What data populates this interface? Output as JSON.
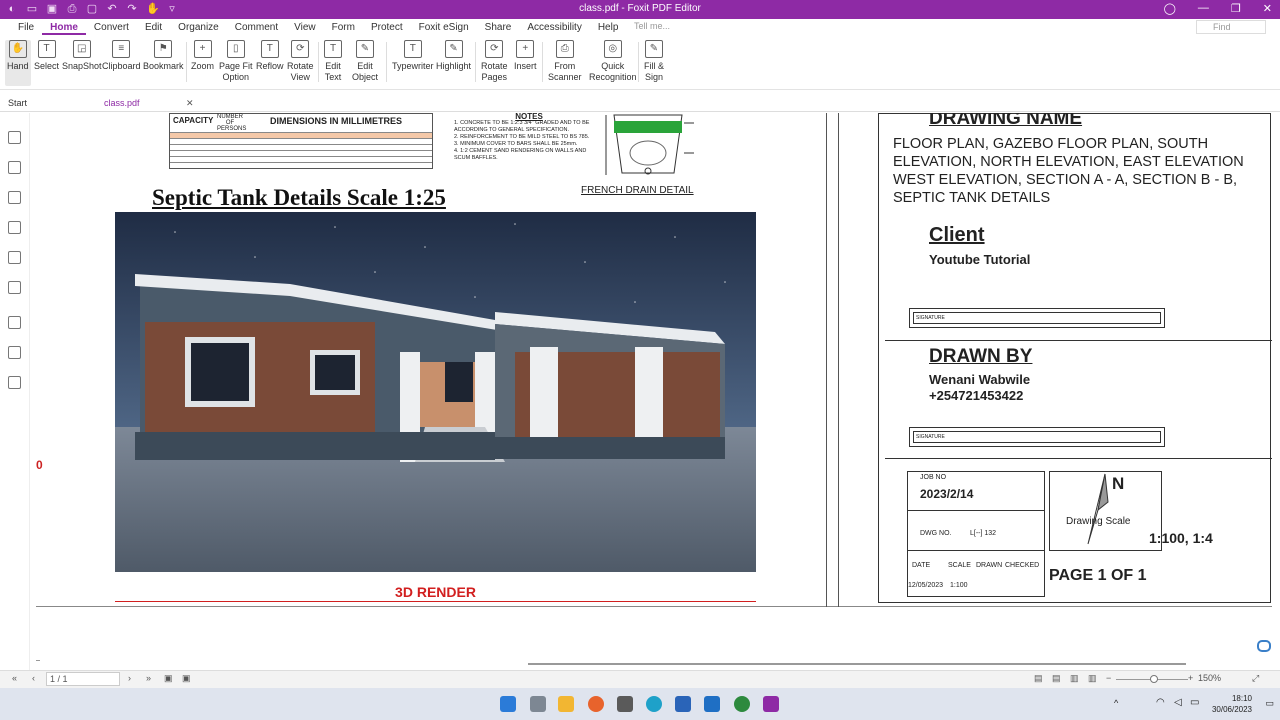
{
  "window": {
    "title": "class.pdf - Foxit PDF Editor"
  },
  "menu": {
    "tabs": [
      "File",
      "Home",
      "Convert",
      "Edit",
      "Organize",
      "Comment",
      "View",
      "Form",
      "Protect",
      "Foxit eSign",
      "Share",
      "Accessibility",
      "Help"
    ],
    "active": "Home",
    "tellme_placeholder": "Tell me...",
    "find_placeholder": "Find"
  },
  "ribbon": [
    {
      "label": "Hand"
    },
    {
      "label": "Select"
    },
    {
      "label": "SnapShot"
    },
    {
      "label": "Clipboard"
    },
    {
      "label": "Bookmark"
    },
    {
      "label": "Zoom"
    },
    {
      "label": "Page Fit\nOption"
    },
    {
      "label": "Reflow"
    },
    {
      "label": "Rotate\nView"
    },
    {
      "label": "Edit\nText"
    },
    {
      "label": "Edit\nObject"
    },
    {
      "label": "Typewriter"
    },
    {
      "label": "Highlight"
    },
    {
      "label": "Rotate\nPages"
    },
    {
      "label": "Insert"
    },
    {
      "label": "From\nScanner"
    },
    {
      "label": "Quick\nRecognition"
    },
    {
      "label": "Fill &\nSign"
    }
  ],
  "doc_tabs": {
    "start": "Start",
    "file": "class.pdf"
  },
  "drawing": {
    "table_capacity": "CAPACITY",
    "table_number": "NUMBER OF PERSONS",
    "table_dims": "DIMENSIONS IN MILLIMETRES",
    "notes_title": "NOTES",
    "notes": [
      "1. CONCRETE TO BE 1:2:3 3/4\" GRADED AND TO BE ACCORDING TO GENERAL SPECIFICATION.",
      "2. REINFORCEMENT TO BE MILD STEEL TO BS 785.",
      "3. MINIMUM COVER TO BARS SHALL BE 25mm.",
      "4. 1:2 CEMENT SAND RENDERING ON WALLS AND SCUM BAFFLES."
    ],
    "french_drain": "FRENCH DRAIN DETAIL",
    "septic_title": "Septic Tank Details  Scale 1:25",
    "render_caption": "3D RENDER",
    "drawing_name_label": "DRAWING NAME",
    "drawing_name_text": "FLOOR PLAN, GAZEBO FLOOR PLAN, SOUTH ELEVATION, NORTH ELEVATION, EAST ELEVATION WEST ELEVATION, SECTION A - A, SECTION B - B, SEPTIC TANK DETAILS",
    "client_label": "Client",
    "client_name": "Youtube Tutorial",
    "signature_label": "SIGNATURE",
    "drawn_by_label": "DRAWN BY",
    "drawn_by_name": "Wenani Wabwile",
    "drawn_by_phone": "+254721453422",
    "job_no_label": "JOB NO",
    "job_no": "2023/2/14",
    "dwg_no_label": "DWG NO.",
    "dwg_no": "L[--]  132",
    "date_label": "DATE",
    "scale_label": "SCALE",
    "drawn_label": "DRAWN",
    "checked_label": "CHECKED",
    "date": "12/05/2023",
    "scale_value": "1:100",
    "north": "N",
    "drawing_scale": "Drawing Scale",
    "scales": "1:100, 1:4",
    "page_of": "PAGE 1 OF 1"
  },
  "status": {
    "page": "1 / 1",
    "zoom": "150%"
  },
  "clock": {
    "time": "18:10",
    "date": "30/06/2023"
  }
}
